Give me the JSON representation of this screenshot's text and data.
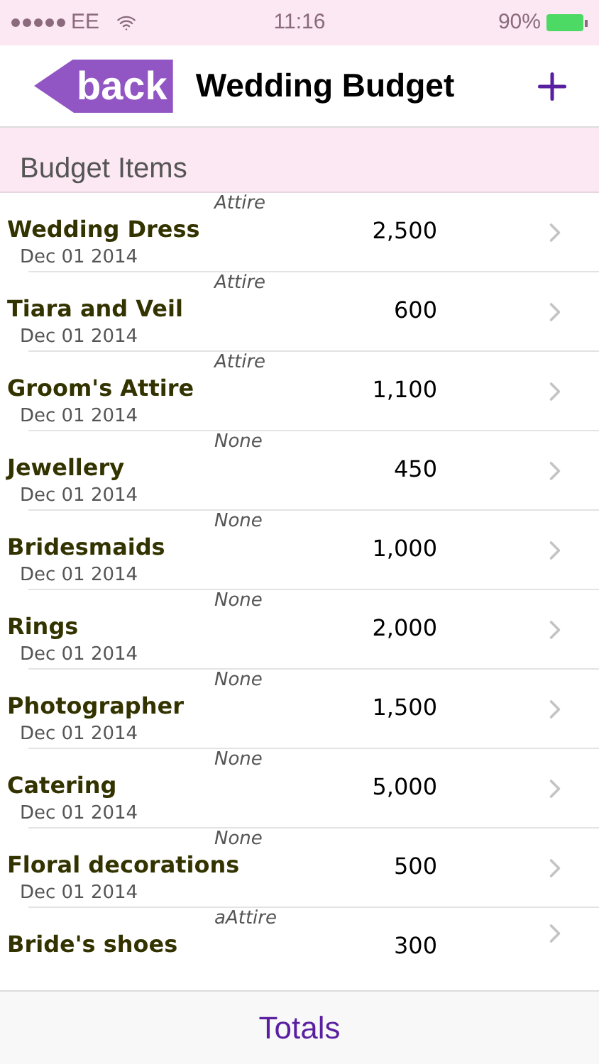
{
  "status_bar": {
    "carrier": "EE",
    "time": "11:16",
    "battery": "90%"
  },
  "nav": {
    "back": "back",
    "title": "Wedding Budget"
  },
  "section": "Budget Items",
  "items": [
    {
      "category": "Attire",
      "name": "Wedding Dress",
      "date": "Dec 01 2014",
      "amount": "2,500"
    },
    {
      "category": "Attire",
      "name": "Tiara and Veil",
      "date": "Dec 01 2014",
      "amount": "600"
    },
    {
      "category": "Attire",
      "name": "Groom's Attire",
      "date": "Dec 01 2014",
      "amount": "1,100"
    },
    {
      "category": "None",
      "name": "Jewellery",
      "date": "Dec 01 2014",
      "amount": "450"
    },
    {
      "category": "None",
      "name": "Bridesmaids",
      "date": "Dec 01 2014",
      "amount": "1,000"
    },
    {
      "category": "None",
      "name": "Rings",
      "date": "Dec 01 2014",
      "amount": "2,000"
    },
    {
      "category": "None",
      "name": "Photographer",
      "date": "Dec 01 2014",
      "amount": "1,500"
    },
    {
      "category": "None",
      "name": "Catering",
      "date": "Dec 01 2014",
      "amount": "5,000"
    },
    {
      "category": "None",
      "name": "Floral decorations",
      "date": "Dec 01 2014",
      "amount": "500"
    },
    {
      "category": "aAttire",
      "name": "Bride's shoes",
      "amount": "300"
    }
  ],
  "toolbar": {
    "button": "Totals"
  }
}
